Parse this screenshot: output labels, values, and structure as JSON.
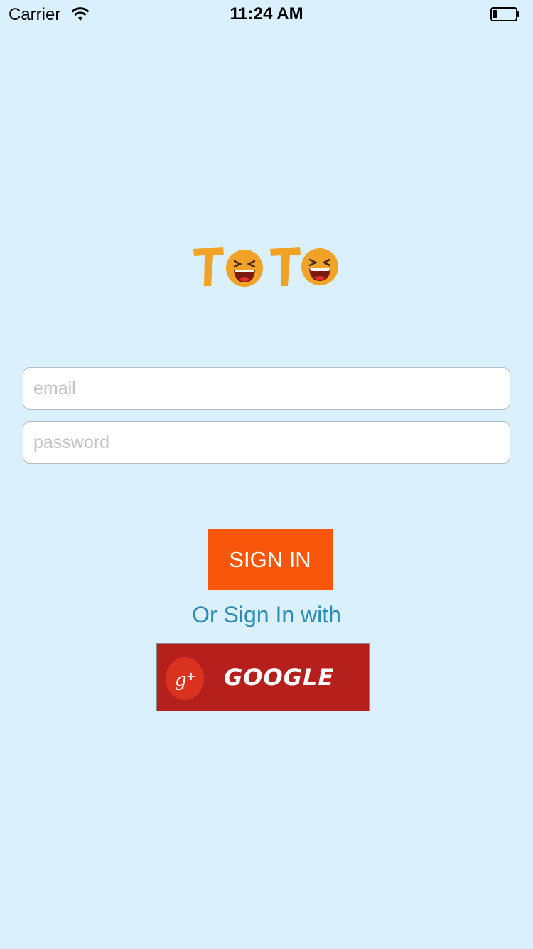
{
  "status_bar": {
    "carrier": "Carrier",
    "time": "11:24 AM"
  },
  "logo": {
    "text": "TOTO",
    "icon": "laughing-face-icon",
    "color": "#f3a228"
  },
  "form": {
    "email_placeholder": "email",
    "email_value": "",
    "password_placeholder": "password",
    "password_value": ""
  },
  "actions": {
    "sign_in_label": "SIGN IN",
    "alt_sign_in_text": "Or Sign In with",
    "google_label": "GOOGLE",
    "google_icon": "google-plus-icon"
  },
  "colors": {
    "background": "#daf1fd",
    "sign_in": "#f7560b",
    "google": "#b51f1c",
    "link_text": "#2a8bb6"
  }
}
